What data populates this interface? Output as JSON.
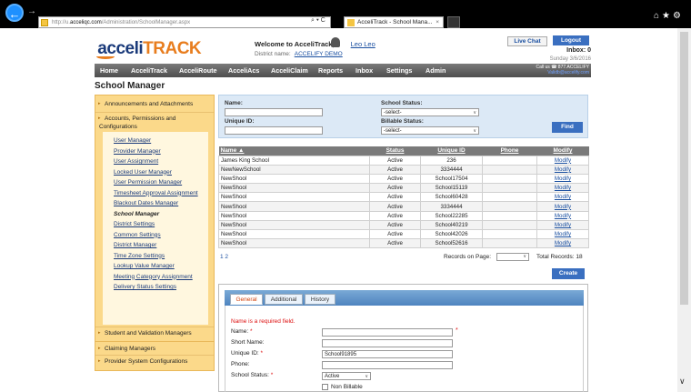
{
  "browser": {
    "url_prefix": "http://u.",
    "url_domain": "acceliqc.com",
    "url_path": "/Administration/SchoolManager.aspx",
    "addr_controls": "⌕ ▾ C",
    "tab_title": "AcceliTrack - School Mana...",
    "tab_close": "×",
    "back_icon": "←",
    "fwd_icon": "→",
    "right_icons": "⌂★⚙",
    "scroll_down": "∨"
  },
  "header": {
    "logo_left": " acceli",
    "logo_right": "TRACK",
    "welcome": "Welcome to AcceliTrack,",
    "user_name": "Leo Leo",
    "district_label": "District name:",
    "district_name": "ACCELIFY DEMO",
    "live_chat": "Live Chat",
    "logout": "Logout",
    "inbox": "Inbox: 0",
    "date": "Sunday 3/6/2016"
  },
  "nav": {
    "items": [
      "Home",
      "AcceliTrack",
      "AcceliRoute",
      "AcceliAcs",
      "AcceliClaim",
      "Reports",
      "Inbox",
      "Settings",
      "Admin"
    ],
    "callus_line1": "Call us ☎ 877.ACCELIFY",
    "callus_line2": "Validb@accelify.com"
  },
  "page_title": "School Manager",
  "sidebar": {
    "top": [
      "Announcements and Attachments",
      "Accounts, Permissions and",
      "Configurations"
    ],
    "sub": [
      "User Manager",
      "Provider Manager",
      "User Assignment",
      "Locked User Manager",
      "User Permission Manager",
      "Timesheet Approval Assignment",
      "Blackout Dates Manager",
      "School Manager",
      "District Settings",
      "Common Settings",
      "District Manager",
      "Time Zone Settings",
      "Lookup Value Manager",
      "Meeting Category Assignment",
      "Delivery Status Settings"
    ],
    "bottom": [
      "Student and Validation Managers",
      "Claiming Managers",
      "Provider System Configurations"
    ],
    "arrow": "▸"
  },
  "search": {
    "name_label": "Name:",
    "unique_label": "Unique ID:",
    "status_label": "School Status:",
    "status_value": "-select-",
    "billable_label": "Billable Status:",
    "billable_value": "-select-",
    "find": "Find",
    "chevron": "∨"
  },
  "grid": {
    "headers": [
      "Name ▲",
      "Status",
      "Unique ID",
      "Phone",
      "Modify"
    ],
    "rows": [
      [
        "James King School",
        "Active",
        "236",
        "",
        "Modify"
      ],
      [
        "NewNewSchool",
        "Active",
        "3334444",
        "",
        "Modify"
      ],
      [
        "NewShool",
        "Active",
        "School17504",
        "",
        "Modify"
      ],
      [
        "NewShool",
        "Active",
        "School15119",
        "",
        "Modify"
      ],
      [
        "NewShool",
        "Active",
        "School60428",
        "",
        "Modify"
      ],
      [
        "NewShool",
        "Active",
        "3334444",
        "",
        "Modify"
      ],
      [
        "NewShool",
        "Active",
        "School22285",
        "",
        "Modify"
      ],
      [
        "NewShool",
        "Active",
        "School40219",
        "",
        "Modify"
      ],
      [
        "NewShool",
        "Active",
        "School42026",
        "",
        "Modify"
      ],
      [
        "NewShool",
        "Active",
        "School52616",
        "",
        "Modify"
      ]
    ]
  },
  "pager": {
    "pages": "1 2",
    "rows_label": "Records on Page:",
    "total": "Total Records: 18",
    "create": "Create"
  },
  "edit": {
    "tabs": [
      "General",
      "Additional",
      "History"
    ],
    "error": "Name is a required field.",
    "fields": [
      {
        "label": "Name:",
        "req": "*",
        "value": ""
      },
      {
        "label": "Short Name:",
        "req": "",
        "value": ""
      },
      {
        "label": "Unique ID:",
        "req": "*",
        "value": "School91895"
      },
      {
        "label": "Phone:",
        "req": "",
        "value": ""
      },
      {
        "label": "School Status:",
        "req": "*",
        "value": "Active"
      }
    ],
    "name_star": "*",
    "non_billable": "Non Billable"
  }
}
